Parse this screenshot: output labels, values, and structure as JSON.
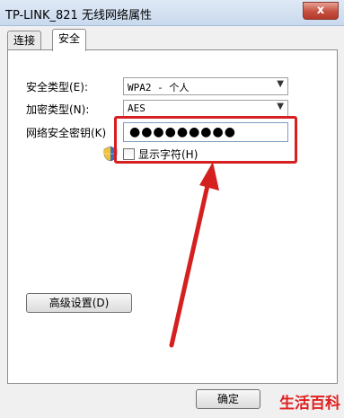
{
  "window": {
    "title": "TP-LINK_821 无线网络属性",
    "close_label": "x"
  },
  "tabs": [
    {
      "label": "连接",
      "active": false
    },
    {
      "label": "安全",
      "active": true
    }
  ],
  "security": {
    "type_label": "安全类型(E):",
    "type_value": "WPA2 - 个人",
    "encryption_label": "加密类型(N):",
    "encryption_value": "AES",
    "key_label": "网络安全密钥(K)",
    "key_value": "●●●●●●●●●",
    "show_chars_label": "显示字符(H)",
    "show_chars_checked": false
  },
  "buttons": {
    "advanced": "高级设置(D)",
    "ok": "确定"
  },
  "watermark": "生活百科",
  "colors": {
    "highlight": "#d52020",
    "accent": "#7a9cc2"
  }
}
